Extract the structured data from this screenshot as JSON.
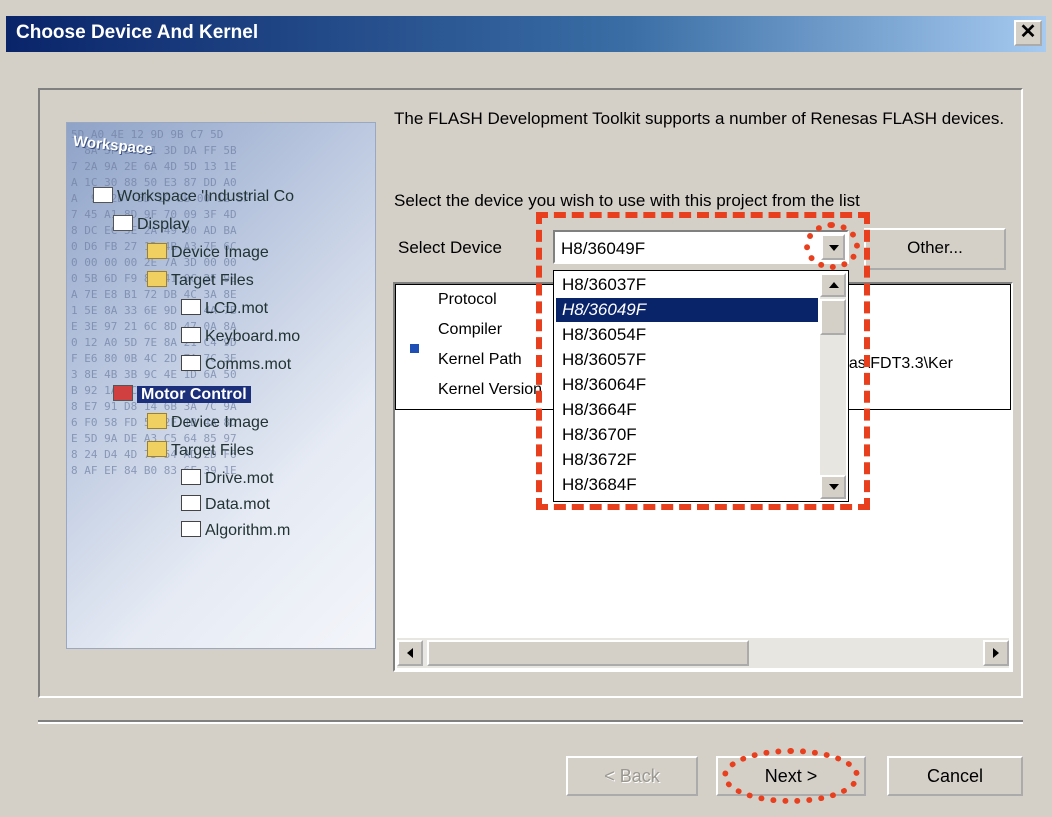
{
  "window": {
    "title": "Choose Device And Kernel",
    "close_glyph": "✕"
  },
  "artwork": {
    "workspace_label": "Workspace",
    "tree": [
      {
        "label": "Workspace 'Industrial Co",
        "icon": "workspace-icon"
      },
      {
        "label": "Display",
        "icon": "project-icon"
      },
      {
        "label": "Device Image",
        "icon": "folder-icon"
      },
      {
        "label": "Target Files",
        "icon": "folder-icon"
      },
      {
        "label": "LCD.mot",
        "icon": "file-icon"
      },
      {
        "label": "Keyboard.mo",
        "icon": "file-icon"
      },
      {
        "label": "Comms.mot",
        "icon": "file-icon"
      },
      {
        "label": "Motor Control",
        "icon": "project-icon"
      },
      {
        "label": "Device Image",
        "icon": "folder-icon"
      },
      {
        "label": "Target Files",
        "icon": "folder-icon"
      },
      {
        "label": "Drive.mot",
        "icon": "file-icon"
      },
      {
        "label": "Data.mot",
        "icon": "file-icon"
      },
      {
        "label": "Algorithm.m",
        "icon": "file-icon"
      }
    ]
  },
  "main": {
    "description": "The FLASH Development Toolkit supports a number of Renesas FLASH devices.",
    "instruction": "Select the device you wish to use with this project from the list",
    "select_label": "Select Device",
    "selected_device": "H8/36049F",
    "other_button": "Other...",
    "properties": [
      {
        "label": "Protocol"
      },
      {
        "label": "Compiler"
      },
      {
        "label": "Kernel Path"
      },
      {
        "label": "Kernel Version"
      }
    ],
    "kernel_path_tail": "esas\\FDT3.3\\Ker"
  },
  "dropdown": {
    "options": [
      "H8/36037F",
      "H8/36049F",
      "H8/36054F",
      "H8/36057F",
      "H8/36064F",
      "H8/3664F",
      "H8/3670F",
      "H8/3672F",
      "H8/3684F"
    ],
    "selected_index": 1
  },
  "footer": {
    "back_label": "< Back",
    "next_label": "Next >",
    "cancel_label": "Cancel"
  },
  "colors": {
    "highlight": "#e8401f",
    "selection": "#0a246a",
    "title_bar": "#0a246a"
  }
}
